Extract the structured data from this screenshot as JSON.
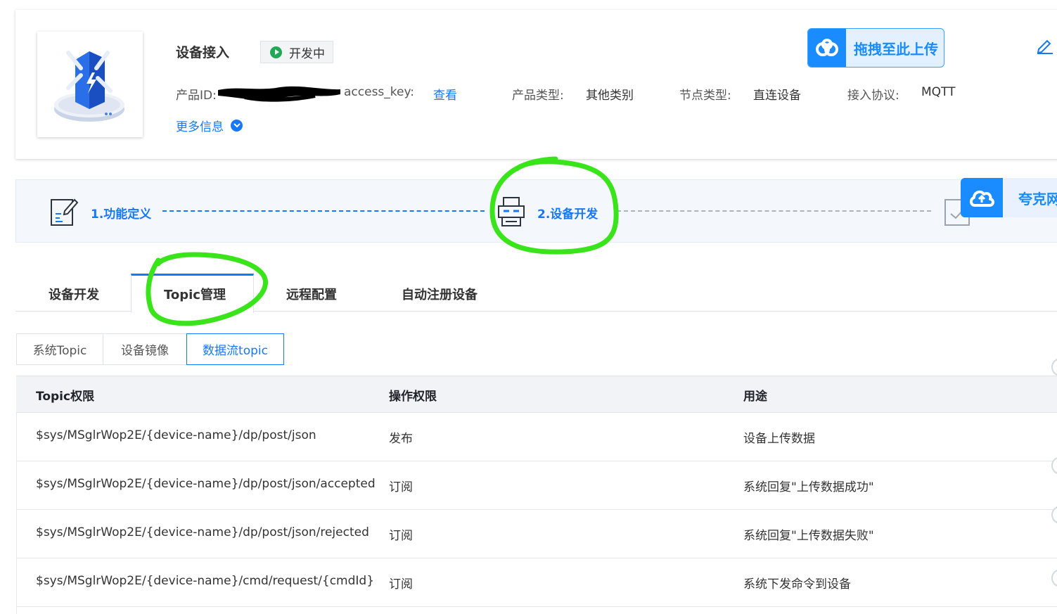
{
  "product": {
    "name": "设备接入",
    "status": "开发中",
    "product_id_label": "产品ID:",
    "access_key_label": "access_key:",
    "access_key_link": "查看",
    "type_label": "产品类型:",
    "type_value": "其他类别",
    "node_label": "节点类型:",
    "node_value": "直连设备",
    "protocol_label": "接入协议:",
    "protocol_value": "MQTT",
    "more_info": "更多信息"
  },
  "upload": {
    "label": "拖拽至此上传"
  },
  "float_widget": {
    "label": "夸克网"
  },
  "steps": [
    {
      "label": "1.功能定义"
    },
    {
      "label": "2.设备开发"
    }
  ],
  "tabs": [
    {
      "label": "设备开发"
    },
    {
      "label": "Topic管理"
    },
    {
      "label": "远程配置"
    },
    {
      "label": "自动注册设备"
    }
  ],
  "subtabs": [
    {
      "label": "系统Topic"
    },
    {
      "label": "设备镜像"
    },
    {
      "label": "数据流topic"
    }
  ],
  "table": {
    "headers": [
      "Topic权限",
      "操作权限",
      "用途"
    ],
    "rows": [
      {
        "topic": "$sys/MSglrWop2E/{device-name}/dp/post/json",
        "op": "发布",
        "use": "设备上传数据"
      },
      {
        "topic": "$sys/MSglrWop2E/{device-name}/dp/post/json/accepted",
        "op": "订阅",
        "use": "系统回复\"上传数据成功\""
      },
      {
        "topic": "$sys/MSglrWop2E/{device-name}/dp/post/json/rejected",
        "op": "订阅",
        "use": "系统回复\"上传数据失败\""
      },
      {
        "topic": "$sys/MSglrWop2E/{device-name}/cmd/request/{cmdId}",
        "op": "订阅",
        "use": "系统下发命令到设备"
      }
    ]
  },
  "colors": {
    "accent": "#1677ff",
    "status_green": "#1fa855",
    "annotation_green": "#39e41a"
  }
}
